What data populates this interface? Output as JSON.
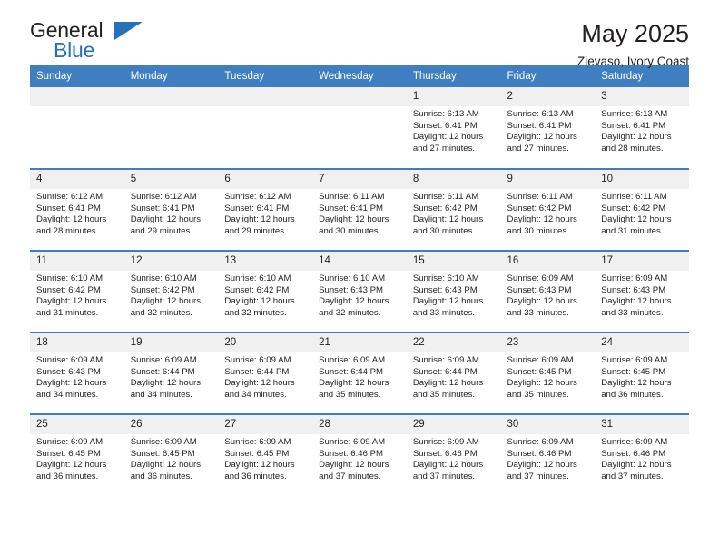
{
  "brand": {
    "name_top": "General",
    "name_bottom": "Blue",
    "triangle_color": "#2572b8"
  },
  "header": {
    "title": "May 2025",
    "subtitle": "Zievaso, Ivory Coast"
  },
  "theme": {
    "header_blue": "#3f7fc1",
    "daynum_gray": "#f0f0f0",
    "text_dark": "#231f20"
  },
  "weekdays": [
    "Sunday",
    "Monday",
    "Tuesday",
    "Wednesday",
    "Thursday",
    "Friday",
    "Saturday"
  ],
  "labels": {
    "sunrise": "Sunrise:",
    "sunset": "Sunset:",
    "daylight": "Daylight:"
  },
  "weeks": [
    [
      {
        "blank": true
      },
      {
        "blank": true
      },
      {
        "blank": true
      },
      {
        "blank": true
      },
      {
        "day": "1",
        "sunrise": "Sunrise: 6:13 AM",
        "sunset": "Sunset: 6:41 PM",
        "daylight": "Daylight: 12 hours and 27 minutes."
      },
      {
        "day": "2",
        "sunrise": "Sunrise: 6:13 AM",
        "sunset": "Sunset: 6:41 PM",
        "daylight": "Daylight: 12 hours and 27 minutes."
      },
      {
        "day": "3",
        "sunrise": "Sunrise: 6:13 AM",
        "sunset": "Sunset: 6:41 PM",
        "daylight": "Daylight: 12 hours and 28 minutes."
      }
    ],
    [
      {
        "day": "4",
        "sunrise": "Sunrise: 6:12 AM",
        "sunset": "Sunset: 6:41 PM",
        "daylight": "Daylight: 12 hours and 28 minutes."
      },
      {
        "day": "5",
        "sunrise": "Sunrise: 6:12 AM",
        "sunset": "Sunset: 6:41 PM",
        "daylight": "Daylight: 12 hours and 29 minutes."
      },
      {
        "day": "6",
        "sunrise": "Sunrise: 6:12 AM",
        "sunset": "Sunset: 6:41 PM",
        "daylight": "Daylight: 12 hours and 29 minutes."
      },
      {
        "day": "7",
        "sunrise": "Sunrise: 6:11 AM",
        "sunset": "Sunset: 6:41 PM",
        "daylight": "Daylight: 12 hours and 30 minutes."
      },
      {
        "day": "8",
        "sunrise": "Sunrise: 6:11 AM",
        "sunset": "Sunset: 6:42 PM",
        "daylight": "Daylight: 12 hours and 30 minutes."
      },
      {
        "day": "9",
        "sunrise": "Sunrise: 6:11 AM",
        "sunset": "Sunset: 6:42 PM",
        "daylight": "Daylight: 12 hours and 30 minutes."
      },
      {
        "day": "10",
        "sunrise": "Sunrise: 6:11 AM",
        "sunset": "Sunset: 6:42 PM",
        "daylight": "Daylight: 12 hours and 31 minutes."
      }
    ],
    [
      {
        "day": "11",
        "sunrise": "Sunrise: 6:10 AM",
        "sunset": "Sunset: 6:42 PM",
        "daylight": "Daylight: 12 hours and 31 minutes."
      },
      {
        "day": "12",
        "sunrise": "Sunrise: 6:10 AM",
        "sunset": "Sunset: 6:42 PM",
        "daylight": "Daylight: 12 hours and 32 minutes."
      },
      {
        "day": "13",
        "sunrise": "Sunrise: 6:10 AM",
        "sunset": "Sunset: 6:42 PM",
        "daylight": "Daylight: 12 hours and 32 minutes."
      },
      {
        "day": "14",
        "sunrise": "Sunrise: 6:10 AM",
        "sunset": "Sunset: 6:43 PM",
        "daylight": "Daylight: 12 hours and 32 minutes."
      },
      {
        "day": "15",
        "sunrise": "Sunrise: 6:10 AM",
        "sunset": "Sunset: 6:43 PM",
        "daylight": "Daylight: 12 hours and 33 minutes."
      },
      {
        "day": "16",
        "sunrise": "Sunrise: 6:09 AM",
        "sunset": "Sunset: 6:43 PM",
        "daylight": "Daylight: 12 hours and 33 minutes."
      },
      {
        "day": "17",
        "sunrise": "Sunrise: 6:09 AM",
        "sunset": "Sunset: 6:43 PM",
        "daylight": "Daylight: 12 hours and 33 minutes."
      }
    ],
    [
      {
        "day": "18",
        "sunrise": "Sunrise: 6:09 AM",
        "sunset": "Sunset: 6:43 PM",
        "daylight": "Daylight: 12 hours and 34 minutes."
      },
      {
        "day": "19",
        "sunrise": "Sunrise: 6:09 AM",
        "sunset": "Sunset: 6:44 PM",
        "daylight": "Daylight: 12 hours and 34 minutes."
      },
      {
        "day": "20",
        "sunrise": "Sunrise: 6:09 AM",
        "sunset": "Sunset: 6:44 PM",
        "daylight": "Daylight: 12 hours and 34 minutes."
      },
      {
        "day": "21",
        "sunrise": "Sunrise: 6:09 AM",
        "sunset": "Sunset: 6:44 PM",
        "daylight": "Daylight: 12 hours and 35 minutes."
      },
      {
        "day": "22",
        "sunrise": "Sunrise: 6:09 AM",
        "sunset": "Sunset: 6:44 PM",
        "daylight": "Daylight: 12 hours and 35 minutes."
      },
      {
        "day": "23",
        "sunrise": "Sunrise: 6:09 AM",
        "sunset": "Sunset: 6:45 PM",
        "daylight": "Daylight: 12 hours and 35 minutes."
      },
      {
        "day": "24",
        "sunrise": "Sunrise: 6:09 AM",
        "sunset": "Sunset: 6:45 PM",
        "daylight": "Daylight: 12 hours and 36 minutes."
      }
    ],
    [
      {
        "day": "25",
        "sunrise": "Sunrise: 6:09 AM",
        "sunset": "Sunset: 6:45 PM",
        "daylight": "Daylight: 12 hours and 36 minutes."
      },
      {
        "day": "26",
        "sunrise": "Sunrise: 6:09 AM",
        "sunset": "Sunset: 6:45 PM",
        "daylight": "Daylight: 12 hours and 36 minutes."
      },
      {
        "day": "27",
        "sunrise": "Sunrise: 6:09 AM",
        "sunset": "Sunset: 6:45 PM",
        "daylight": "Daylight: 12 hours and 36 minutes."
      },
      {
        "day": "28",
        "sunrise": "Sunrise: 6:09 AM",
        "sunset": "Sunset: 6:46 PM",
        "daylight": "Daylight: 12 hours and 37 minutes."
      },
      {
        "day": "29",
        "sunrise": "Sunrise: 6:09 AM",
        "sunset": "Sunset: 6:46 PM",
        "daylight": "Daylight: 12 hours and 37 minutes."
      },
      {
        "day": "30",
        "sunrise": "Sunrise: 6:09 AM",
        "sunset": "Sunset: 6:46 PM",
        "daylight": "Daylight: 12 hours and 37 minutes."
      },
      {
        "day": "31",
        "sunrise": "Sunrise: 6:09 AM",
        "sunset": "Sunset: 6:46 PM",
        "daylight": "Daylight: 12 hours and 37 minutes."
      }
    ]
  ]
}
